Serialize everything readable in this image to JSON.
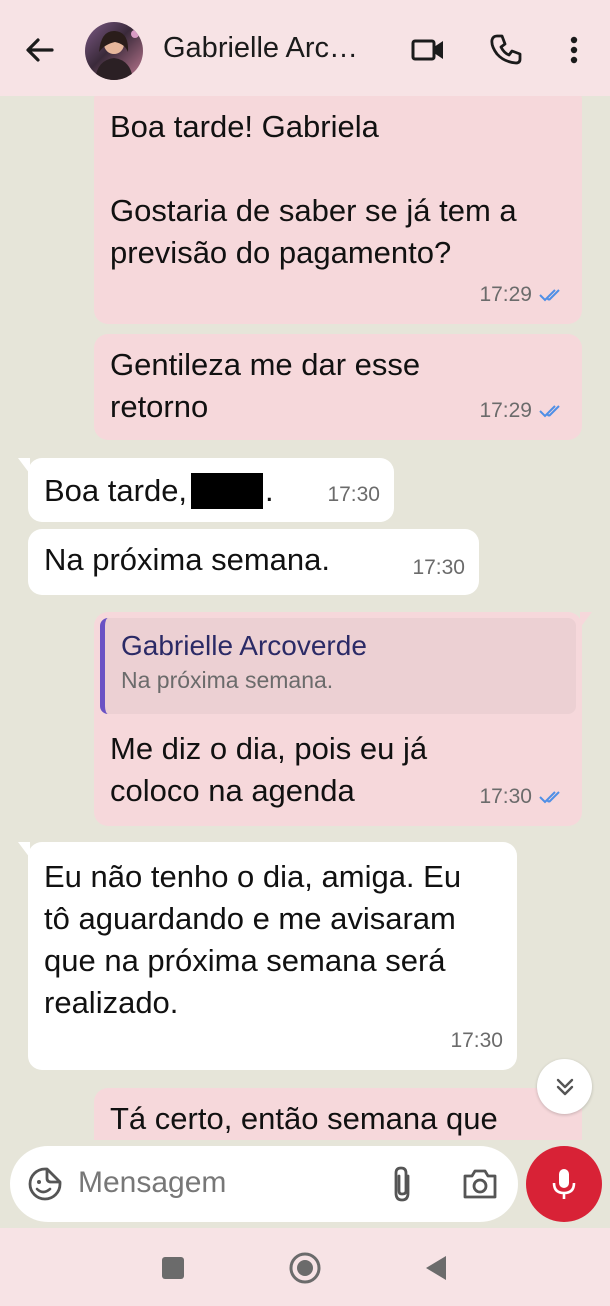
{
  "header": {
    "contact_name": "Gabrielle Arc…",
    "back_icon": "arrow-left-icon",
    "video_icon": "video-call-icon",
    "call_icon": "phone-icon",
    "menu_icon": "more-vert-icon",
    "background": "#f7e3e5"
  },
  "messages": [
    {
      "direction": "out",
      "text": "Boa tarde! Gabriela\n\nGostaria de saber se já tem a previsão do pagamento?",
      "time": "17:29",
      "status": "read"
    },
    {
      "direction": "out",
      "text": "Gentileza me dar esse retorno",
      "time": "17:29",
      "status": "read"
    },
    {
      "direction": "in",
      "text_before": "Boa tarde,",
      "text_after": ".",
      "redacted": true,
      "time": "17:30"
    },
    {
      "direction": "in",
      "text": "Na próxima semana.",
      "time": "17:30"
    },
    {
      "direction": "out",
      "quote_author": "Gabrielle Arcoverde",
      "quote_text": "Na próxima semana.",
      "text": "Me diz o dia, pois eu já coloco na agenda",
      "time": "17:30",
      "status": "read"
    },
    {
      "direction": "in",
      "text": "Eu não tenho o dia, amiga. Eu tô aguardando e me avisaram que na próxima semana será realizado.",
      "time": "17:30"
    },
    {
      "direction": "out",
      "text": "Tá certo, então semana que",
      "partial": true
    }
  ],
  "composer": {
    "placeholder": "Mensagem",
    "emoji_icon": "sticker-emoji-icon",
    "attach_icon": "paperclip-icon",
    "camera_icon": "camera-icon",
    "mic_icon": "microphone-icon",
    "mic_color": "#d82236"
  },
  "colors": {
    "chat_background": "#e6e5d9",
    "outgoing_bubble": "#f6d8db",
    "incoming_bubble": "#ffffff",
    "read_ticks": "#4f8fe6",
    "quote_bar": "#6a52c4"
  }
}
